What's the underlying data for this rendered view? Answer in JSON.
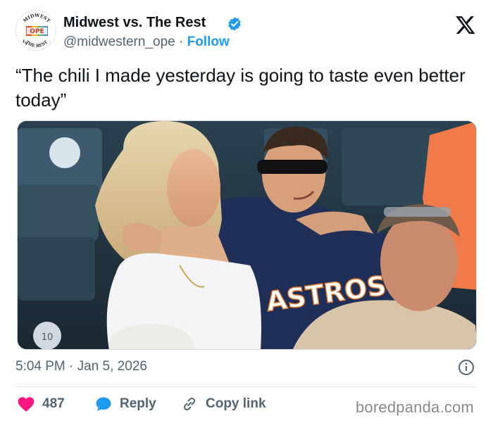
{
  "author": {
    "display_name": "Midwest vs. The Rest",
    "handle": "@midwestern_ope",
    "separator": "·",
    "follow_label": "Follow",
    "avatar_text": {
      "top": "MIDWEST",
      "middle": "OPE",
      "bottom": "THE REST",
      "side": "VS"
    }
  },
  "tweet": {
    "text": "“The chili I made yesterday is going to taste even better today”",
    "timestamp": "5:04 PM · Jan 5, 2026"
  },
  "media": {
    "jersey_text": "ASTROS",
    "seat_number": "10"
  },
  "actions": {
    "like_count": "487",
    "reply_label": "Reply",
    "copy_link_label": "Copy link"
  },
  "watermark": "boredpanda.com",
  "colors": {
    "accent": "#1d9bf0",
    "like": "#f91880",
    "secondary_text": "#536471"
  },
  "icons": [
    "verified-badge-icon",
    "x-logo-icon",
    "info-icon",
    "heart-icon",
    "reply-bubble-icon",
    "link-icon"
  ]
}
